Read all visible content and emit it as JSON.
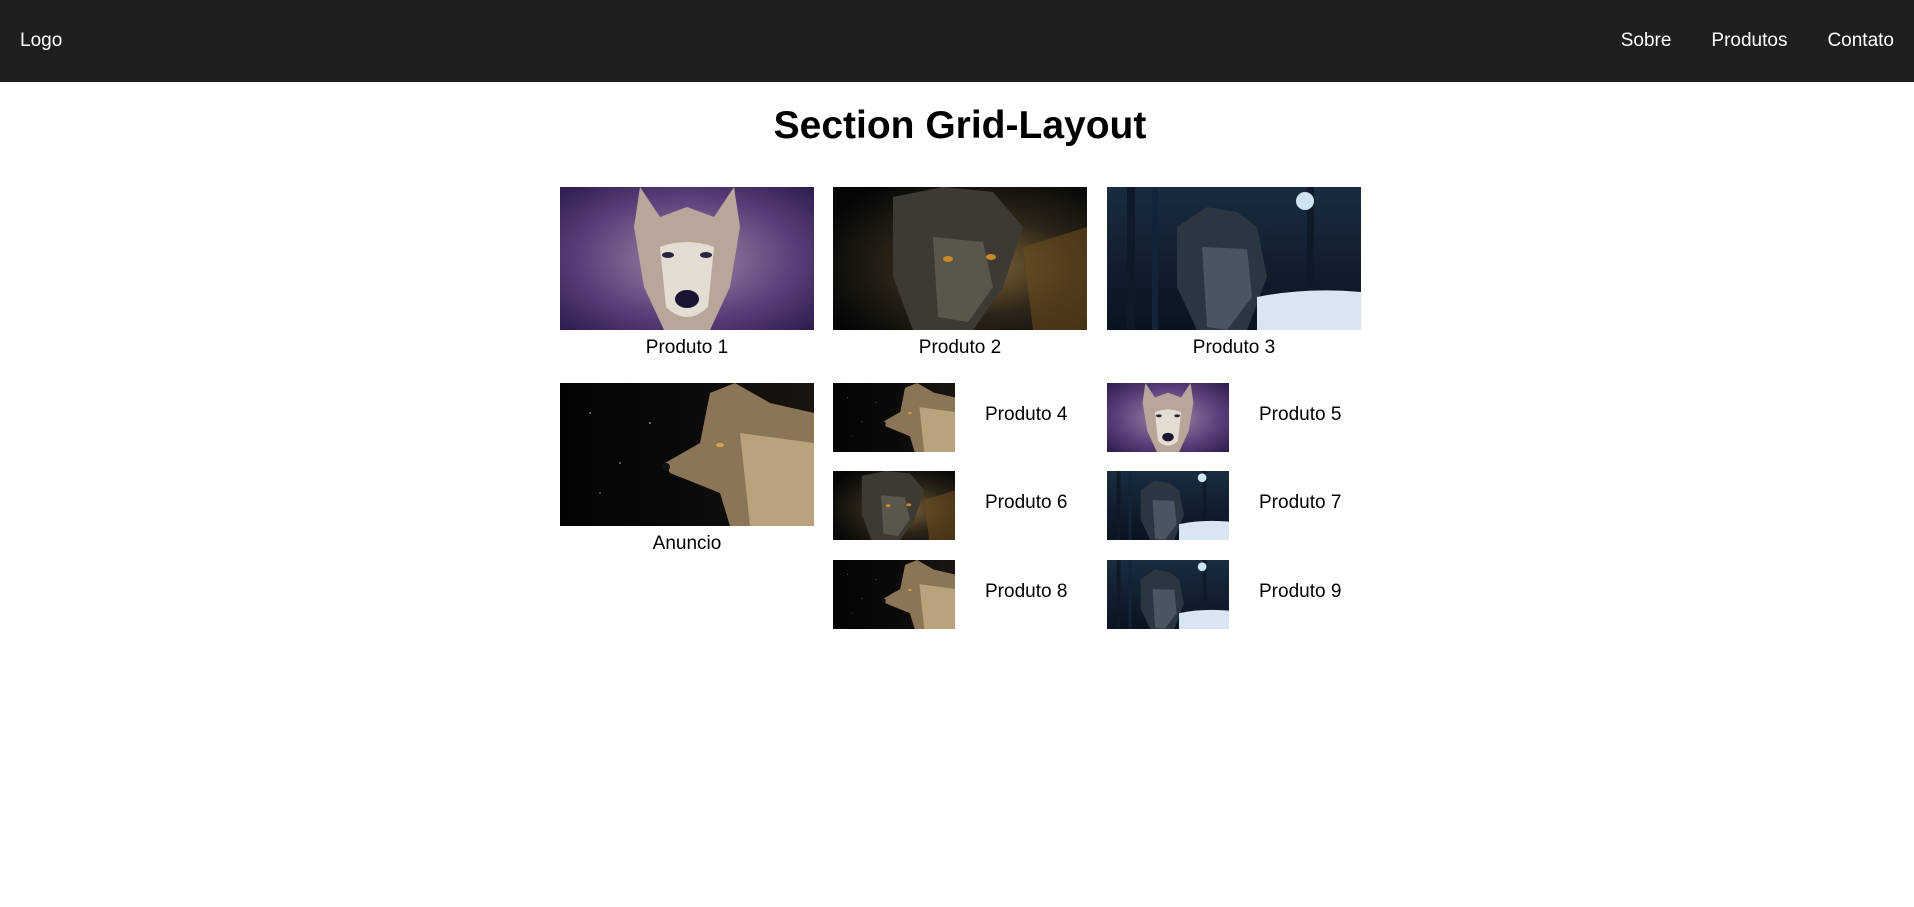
{
  "navbar": {
    "logo": "Logo",
    "links": [
      "Sobre",
      "Produtos",
      "Contato"
    ]
  },
  "section": {
    "title": "Section Grid-Layout",
    "featured": [
      {
        "label": "Produto 1",
        "image": "wolf-purple"
      },
      {
        "label": "Produto 2",
        "image": "wolf-dark-amber"
      },
      {
        "label": "Produto 3",
        "image": "wolf-forest-night"
      }
    ],
    "ad": {
      "label": "Anuncio",
      "image": "wolf-profile-night"
    },
    "small": [
      {
        "label": "Produto 4",
        "image": "wolf-profile-night"
      },
      {
        "label": "Produto 5",
        "image": "wolf-purple"
      },
      {
        "label": "Produto 6",
        "image": "wolf-dark-amber"
      },
      {
        "label": "Produto 7",
        "image": "wolf-forest-night"
      },
      {
        "label": "Produto 8",
        "image": "wolf-profile-night"
      },
      {
        "label": "Produto 9",
        "image": "wolf-forest-night"
      }
    ]
  },
  "colors": {
    "navbar_bg": "#1e1f20",
    "navbar_text": "#ffffff",
    "page_bg": "#ffffff"
  }
}
